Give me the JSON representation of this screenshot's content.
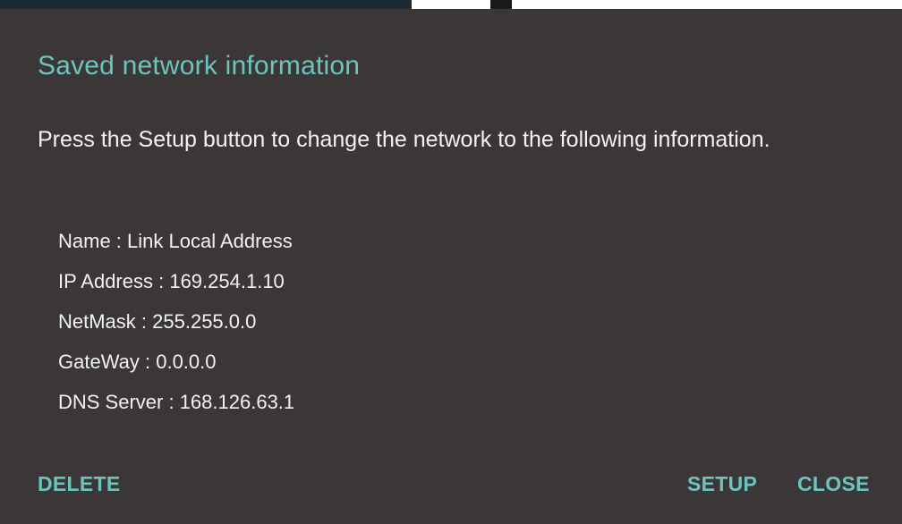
{
  "dialog": {
    "title": "Saved network information",
    "message": "Press the Setup button to change the network to the following information.",
    "info": [
      "Name : Link Local Address",
      "IP Address : 169.254.1.10",
      "NetMask : 255.255.0.0",
      "GateWay : 0.0.0.0",
      "DNS Server : 168.126.63.1"
    ],
    "buttons": {
      "delete": "DELETE",
      "setup": "SETUP",
      "close": "CLOSE"
    }
  },
  "colors": {
    "dialog_bg": "#3b3738",
    "accent": "#6cc4bc",
    "text": "#f2f2f2"
  }
}
